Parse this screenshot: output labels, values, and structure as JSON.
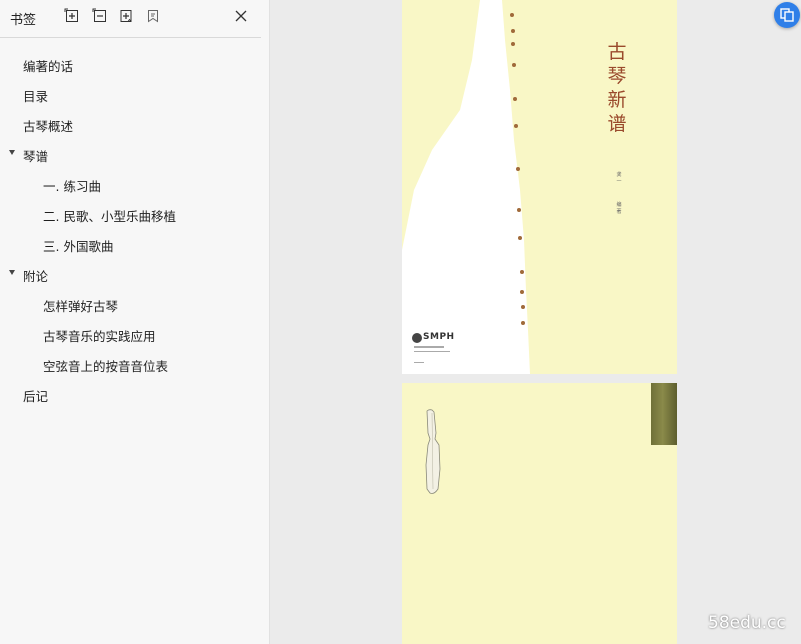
{
  "bookmark_panel": {
    "title": "书签",
    "toolbar_icons": [
      "expand-all-icon",
      "collapse-all-icon",
      "add-bookmark-icon",
      "bookmark-options-icon"
    ],
    "close_icon": "close-icon",
    "items": [
      {
        "label": "编著的话",
        "level": 0,
        "expanded": null
      },
      {
        "label": "目录",
        "level": 0,
        "expanded": null
      },
      {
        "label": "古琴概述",
        "level": 0,
        "expanded": null
      },
      {
        "label": "琴谱",
        "level": 0,
        "expanded": true
      },
      {
        "label": "一. 练习曲",
        "level": 1,
        "expanded": null
      },
      {
        "label": "二. 民歌、小型乐曲移植",
        "level": 1,
        "expanded": null
      },
      {
        "label": "三. 外国歌曲",
        "level": 1,
        "expanded": null
      },
      {
        "label": "附论",
        "level": 0,
        "expanded": true
      },
      {
        "label": "怎样弹好古琴",
        "level": 1,
        "expanded": null
      },
      {
        "label": "古琴音乐的实践应用",
        "level": 1,
        "expanded": null
      },
      {
        "label": "空弦音上的按音音位表",
        "level": 1,
        "expanded": null
      },
      {
        "label": "后记",
        "level": 0,
        "expanded": null
      }
    ]
  },
  "document": {
    "cover": {
      "title_chars": [
        "古",
        "琴",
        "新",
        "谱"
      ],
      "author_chars": [
        "龚",
        "一",
        "编",
        "著"
      ],
      "publisher_logo": "SMPH"
    }
  },
  "floating_button_icon": "window-switch-icon",
  "watermark": "58edu.cc",
  "colors": {
    "accent": "#2f7fe8",
    "page_background": "#f9f7c6",
    "title_red": "#9a4a2c",
    "spine_olive": "#7a7a40"
  }
}
